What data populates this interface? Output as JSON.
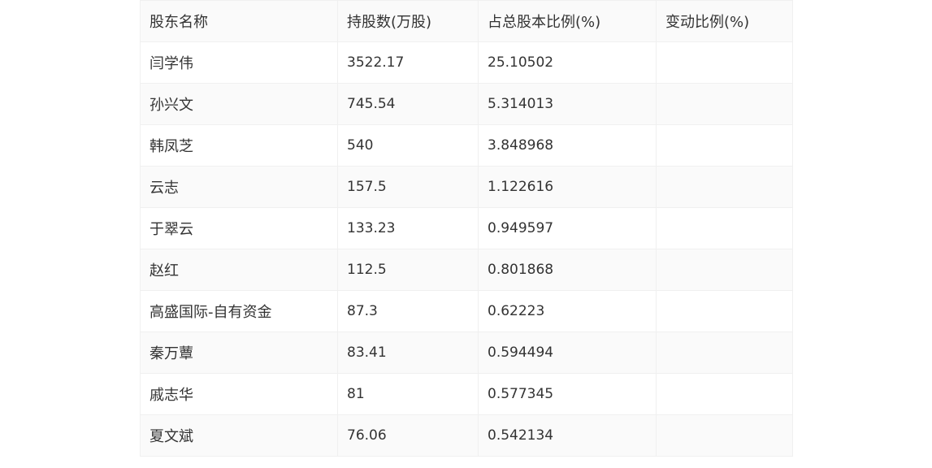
{
  "table": {
    "headers": [
      "股东名称",
      "持股数(万股)",
      "占总股本比例(%)",
      "变动比例(%)"
    ],
    "rows": [
      [
        "闫学伟",
        "3522.17",
        "25.10502",
        ""
      ],
      [
        "孙兴文",
        "745.54",
        "5.314013",
        ""
      ],
      [
        "韩凤芝",
        "540",
        "3.848968",
        ""
      ],
      [
        "云志",
        "157.5",
        "1.122616",
        ""
      ],
      [
        "于翠云",
        "133.23",
        "0.949597",
        ""
      ],
      [
        "赵红",
        "112.5",
        "0.801868",
        ""
      ],
      [
        "高盛国际-自有资金",
        "87.3",
        "0.62223",
        ""
      ],
      [
        "秦万蕈",
        "83.41",
        "0.594494",
        ""
      ],
      [
        "戚志华",
        "81",
        "0.577345",
        ""
      ],
      [
        "夏文斌",
        "76.06",
        "0.542134",
        ""
      ]
    ]
  }
}
